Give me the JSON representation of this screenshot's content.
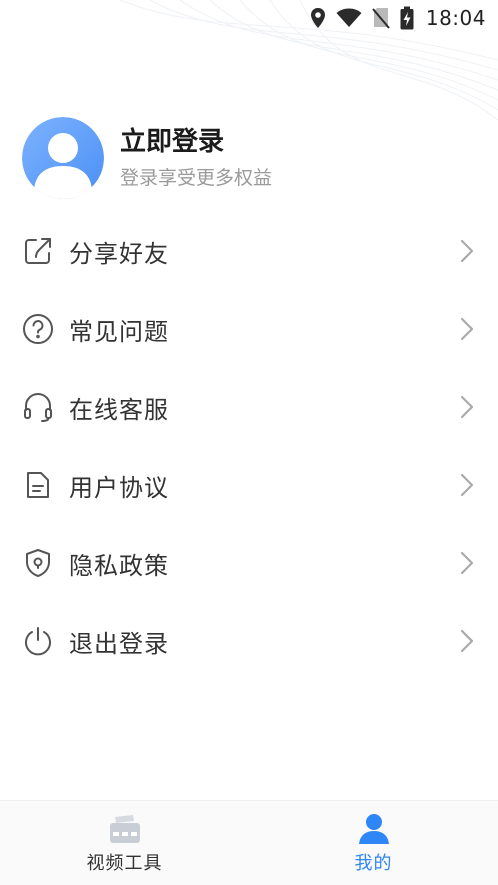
{
  "status_bar": {
    "time": "18:04",
    "icons": [
      "location-icon",
      "wifi-icon",
      "no-sim-icon",
      "battery-charging-icon"
    ]
  },
  "profile": {
    "title": "立即登录",
    "subtitle": "登录享受更多权益",
    "avatar_icon": "default-avatar-icon"
  },
  "menu": {
    "items": [
      {
        "label": "分享好友",
        "icon": "share-icon"
      },
      {
        "label": "常见问题",
        "icon": "question-circle-icon"
      },
      {
        "label": "在线客服",
        "icon": "headset-icon"
      },
      {
        "label": "用户协议",
        "icon": "document-icon"
      },
      {
        "label": "隐私政策",
        "icon": "shield-icon"
      },
      {
        "label": "退出登录",
        "icon": "power-icon"
      }
    ],
    "chevron_icon": "chevron-right-icon"
  },
  "bottom_nav": {
    "tabs": [
      {
        "label": "视频工具",
        "icon": "video-tools-icon",
        "active": false
      },
      {
        "label": "我的",
        "icon": "user-icon",
        "active": true
      }
    ]
  },
  "colors": {
    "accent": "#2f86f6",
    "text_primary": "#333333",
    "text_secondary": "#9a9a9a",
    "icon_gray": "#555555",
    "nav_inactive_icon": "#c9ced6"
  }
}
